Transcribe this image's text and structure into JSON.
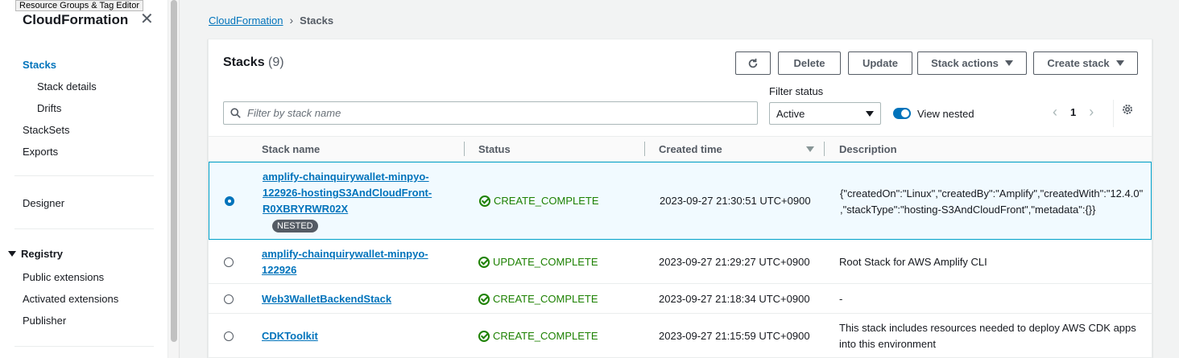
{
  "tooltip": "Resource Groups & Tag Editor",
  "sidebar": {
    "title": "CloudFormation",
    "items": [
      {
        "label": "Stacks"
      },
      {
        "label": "Stack details"
      },
      {
        "label": "Drifts"
      },
      {
        "label": "StackSets"
      },
      {
        "label": "Exports"
      },
      {
        "label": "Designer"
      },
      {
        "label": "Registry"
      },
      {
        "label": "Public extensions"
      },
      {
        "label": "Activated extensions"
      },
      {
        "label": "Publisher"
      }
    ]
  },
  "breadcrumb": {
    "root": "CloudFormation",
    "current": "Stacks"
  },
  "panel": {
    "title": "Stacks",
    "count": "(9)",
    "buttons": {
      "delete": "Delete",
      "update": "Update",
      "stack_actions": "Stack actions",
      "create_stack": "Create stack"
    },
    "filter_status_label": "Filter status",
    "search_placeholder": "Filter by stack name",
    "filter_status_value": "Active",
    "view_nested": "View nested",
    "page": "1"
  },
  "table": {
    "headers": [
      "Stack name",
      "Status",
      "Created time",
      "Description"
    ],
    "rows": [
      {
        "name_lines": [
          "amplify-chainquirywallet-minpyo-",
          "122926-hostingS3AndCloudFront-",
          "R0XBRYRWR02X"
        ],
        "badge": "NESTED",
        "status": "CREATE_COMPLETE",
        "created": "2023-09-27 21:30:51 UTC+0900",
        "desc_lines": [
          "{\"createdOn\":\"Linux\",\"createdBy\":\"Amplify\",\"createdWith\":\"12.4.0\"",
          ",\"stackType\":\"hosting-S3AndCloudFront\",\"metadata\":{}}"
        ]
      },
      {
        "name_lines": [
          "amplify-chainquirywallet-minpyo-",
          "122926"
        ],
        "status": "UPDATE_COMPLETE",
        "created": "2023-09-27 21:29:27 UTC+0900",
        "desc_lines": [
          "Root Stack for AWS Amplify CLI"
        ]
      },
      {
        "name_lines": [
          "Web3WalletBackendStack"
        ],
        "status": "CREATE_COMPLETE",
        "created": "2023-09-27 21:18:34 UTC+0900",
        "desc_lines": [
          "-"
        ]
      },
      {
        "name_lines": [
          "CDKToolkit"
        ],
        "status": "CREATE_COMPLETE",
        "created": "2023-09-27 21:15:59 UTC+0900",
        "desc_lines": [
          "This stack includes resources needed to deploy AWS CDK apps",
          "into this environment"
        ]
      }
    ]
  },
  "colors": {
    "link": "#0073bb",
    "success": "#1d8102",
    "selected_border": "#00a1c9"
  }
}
